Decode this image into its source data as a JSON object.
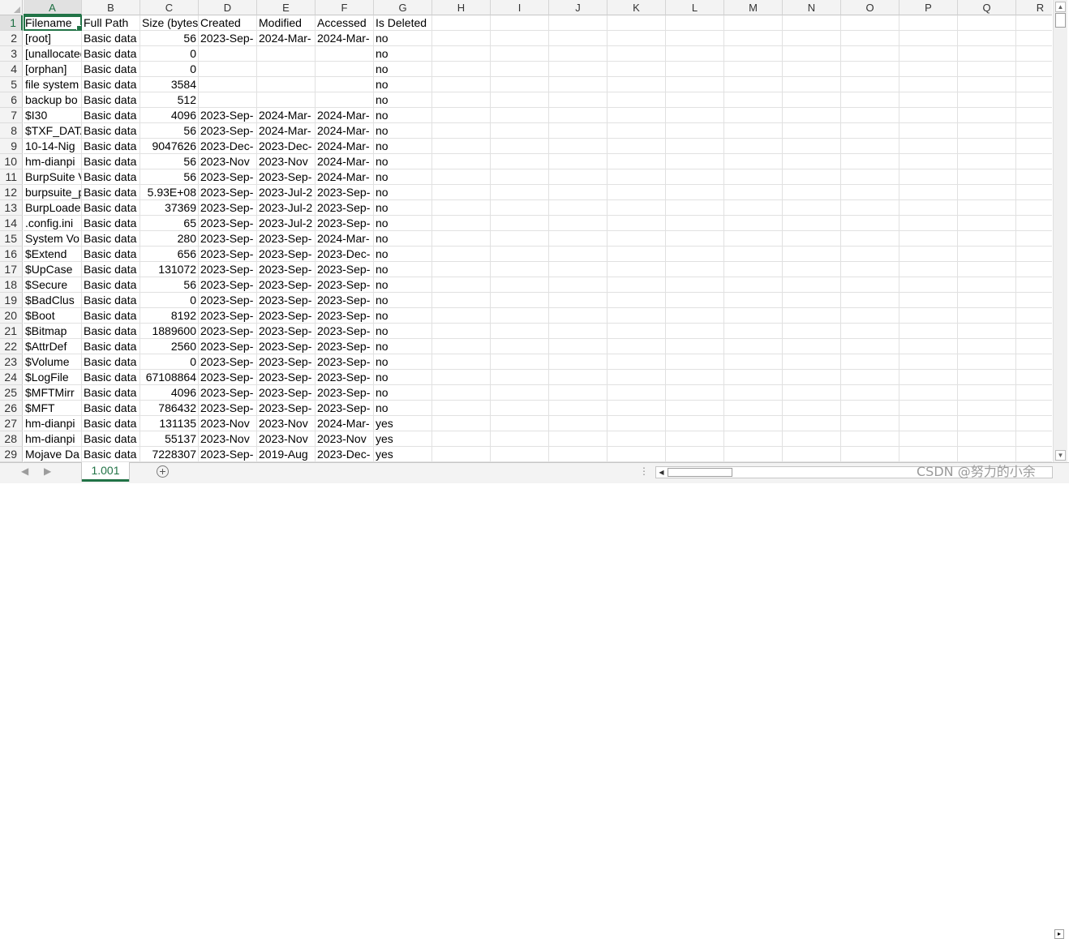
{
  "columns": [
    "A",
    "B",
    "C",
    "D",
    "E",
    "F",
    "G",
    "H",
    "I",
    "J",
    "K",
    "L",
    "M",
    "N",
    "O",
    "P",
    "Q",
    "R"
  ],
  "rows": [
    [
      "1",
      "Filename",
      "Full Path",
      "Size (bytes)",
      "Created",
      "Modified",
      "Accessed",
      "Is Deleted"
    ],
    [
      "2",
      "[root]",
      "Basic data",
      "56",
      "2023-Sep-",
      "2024-Mar-",
      "2024-Mar-",
      "no"
    ],
    [
      "3",
      "[unallocated",
      "Basic data",
      "0",
      "",
      "",
      "",
      "no"
    ],
    [
      "4",
      "[orphan]",
      "Basic data",
      "0",
      "",
      "",
      "",
      "no"
    ],
    [
      "5",
      "file system",
      "Basic data",
      "3584",
      "",
      "",
      "",
      "no"
    ],
    [
      "6",
      "backup bo",
      "Basic data",
      "512",
      "",
      "",
      "",
      "no"
    ],
    [
      "7",
      "$I30",
      "Basic data",
      "4096",
      "2023-Sep-",
      "2024-Mar-",
      "2024-Mar-",
      "no"
    ],
    [
      "8",
      "$TXF_DATA",
      "Basic data",
      "56",
      "2023-Sep-",
      "2024-Mar-",
      "2024-Mar-",
      "no"
    ],
    [
      "9",
      "10-14-Nig",
      "Basic data",
      "9047626",
      "2023-Dec-",
      "2023-Dec-",
      "2024-Mar-",
      "no"
    ],
    [
      "10",
      "hm-dianpi",
      "Basic data",
      "56",
      "2023-Nov",
      "2023-Nov",
      "2024-Mar-",
      "no"
    ],
    [
      "11",
      "BurpSuite V",
      "Basic data",
      "56",
      "2023-Sep-",
      "2023-Sep-",
      "2024-Mar-",
      "no"
    ],
    [
      "12",
      "burpsuite_p",
      "Basic data",
      "5.93E+08",
      "2023-Sep-",
      "2023-Jul-2",
      "2023-Sep-",
      "no"
    ],
    [
      "13",
      "BurpLoade",
      "Basic data",
      "37369",
      "2023-Sep-",
      "2023-Jul-2",
      "2023-Sep-",
      "no"
    ],
    [
      "14",
      ".config.ini",
      "Basic data",
      "65",
      "2023-Sep-",
      "2023-Jul-2",
      "2023-Sep-",
      "no"
    ],
    [
      "15",
      "System Vo",
      "Basic data",
      "280",
      "2023-Sep-",
      "2023-Sep-",
      "2024-Mar-",
      "no"
    ],
    [
      "16",
      "$Extend",
      "Basic data",
      "656",
      "2023-Sep-",
      "2023-Sep-",
      "2023-Dec-",
      "no"
    ],
    [
      "17",
      "$UpCase",
      "Basic data",
      "131072",
      "2023-Sep-",
      "2023-Sep-",
      "2023-Sep-",
      "no"
    ],
    [
      "18",
      "$Secure",
      "Basic data",
      "56",
      "2023-Sep-",
      "2023-Sep-",
      "2023-Sep-",
      "no"
    ],
    [
      "19",
      "$BadClus",
      "Basic data",
      "0",
      "2023-Sep-",
      "2023-Sep-",
      "2023-Sep-",
      "no"
    ],
    [
      "20",
      "$Boot",
      "Basic data",
      "8192",
      "2023-Sep-",
      "2023-Sep-",
      "2023-Sep-",
      "no"
    ],
    [
      "21",
      "$Bitmap",
      "Basic data",
      "1889600",
      "2023-Sep-",
      "2023-Sep-",
      "2023-Sep-",
      "no"
    ],
    [
      "22",
      "$AttrDef",
      "Basic data",
      "2560",
      "2023-Sep-",
      "2023-Sep-",
      "2023-Sep-",
      "no"
    ],
    [
      "23",
      "$Volume",
      "Basic data",
      "0",
      "2023-Sep-",
      "2023-Sep-",
      "2023-Sep-",
      "no"
    ],
    [
      "24",
      "$LogFile",
      "Basic data",
      "67108864",
      "2023-Sep-",
      "2023-Sep-",
      "2023-Sep-",
      "no"
    ],
    [
      "25",
      "$MFTMirr",
      "Basic data",
      "4096",
      "2023-Sep-",
      "2023-Sep-",
      "2023-Sep-",
      "no"
    ],
    [
      "26",
      "$MFT",
      "Basic data",
      "786432",
      "2023-Sep-",
      "2023-Sep-",
      "2023-Sep-",
      "no"
    ],
    [
      "27",
      "hm-dianpi",
      "Basic data",
      "131135",
      "2023-Nov",
      "2023-Nov",
      "2024-Mar-",
      "yes"
    ],
    [
      "28",
      "hm-dianpi",
      "Basic data",
      "55137",
      "2023-Nov",
      "2023-Nov",
      "2023-Nov",
      "yes"
    ],
    [
      "29",
      "Mojave Da",
      "Basic data",
      "7228307",
      "2023-Sep-",
      "2019-Aug",
      "2023-Dec-",
      "yes"
    ]
  ],
  "sheet_tab": "1.001",
  "watermark": "CSDN @努力的小余",
  "icons": {
    "add_sheet": "plus-circle-icon",
    "nav_prev": "triangle-left-icon",
    "nav_next": "triangle-right-icon",
    "scroll_up": "up-arrow-icon",
    "scroll_down": "down-arrow-icon",
    "scroll_left": "left-arrow-icon",
    "scroll_right": "right-arrow-icon"
  },
  "colors": {
    "accent": "#217346",
    "header_bg": "#f3f3f3",
    "gridline": "#e1e1e1"
  }
}
